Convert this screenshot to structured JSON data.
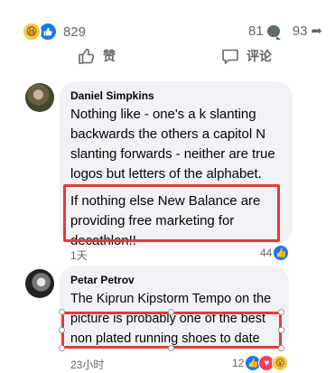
{
  "post_stats": {
    "reaction_icons": [
      "haha-icon",
      "like-icon"
    ],
    "reaction_count": "829",
    "comment_count": "81",
    "share_count": "93"
  },
  "actions": {
    "like_label": "赞",
    "comment_label": "评论"
  },
  "comments": [
    {
      "author": "Daniel Simpkins",
      "text_lines": [
        "Nothing like - one's a k slanting",
        "backwards the others a capitol N",
        "slanting forwards - neither are true",
        "logos but letters of the alphabet."
      ],
      "highlight_lines": [
        "If nothing else New Balance are",
        "providing free marketing for",
        "decathlon!!"
      ],
      "time": "1天",
      "reaction_count": "44",
      "reaction_icons": [
        "like-icon"
      ]
    },
    {
      "author": "Petar Petrov",
      "text_lines": [
        "The Kiprun Kipstorm Tempo on the"
      ],
      "highlight_lines": [
        "picture is probably one of the best",
        "non plated running shoes to date"
      ],
      "time": "23小时",
      "reaction_count": "12",
      "reaction_icons": [
        "like-icon",
        "love-icon",
        "wow-icon"
      ]
    }
  ],
  "colors": {
    "bubble": "#f0f2f5",
    "highlight": "#e23b3b",
    "like_blue": "#1877f2",
    "muted": "#65676b"
  }
}
